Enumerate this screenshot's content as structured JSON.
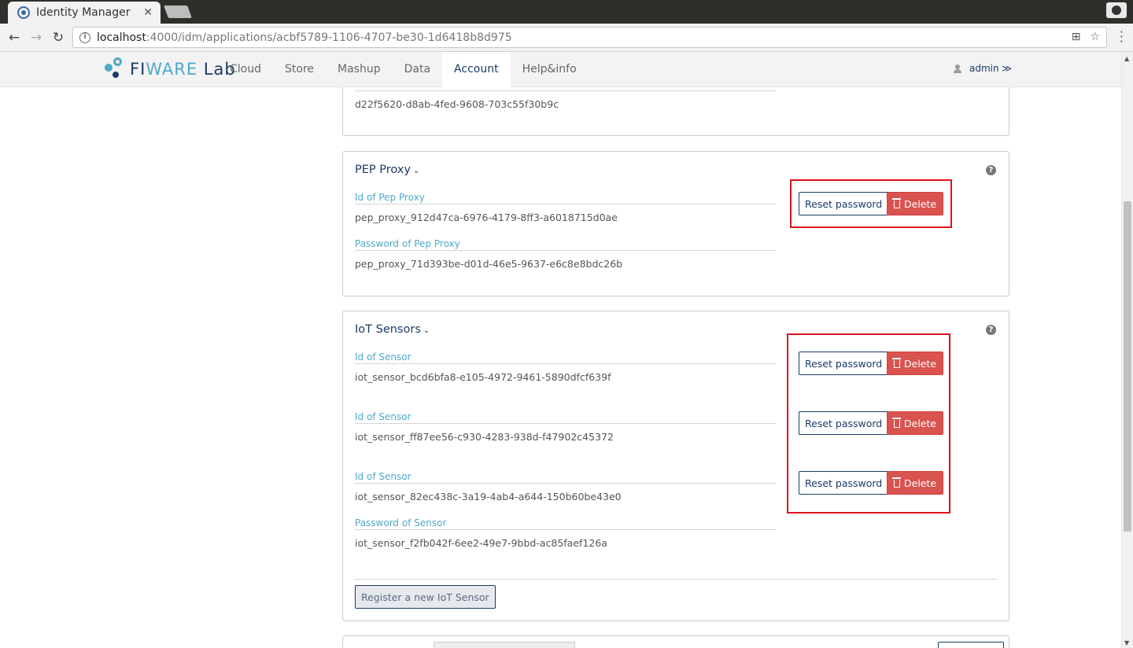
{
  "browser": {
    "tab_title": "Identity Manager",
    "tab_close": "✕",
    "url_host": "localhost",
    "url_rest": ":4000/idm/applications/acbf5789-1106-4707-be30-1d6418b8d975"
  },
  "header": {
    "brand_main": "FI",
    "brand_ware": "WARE",
    "brand_lab": " Lab",
    "nav": [
      {
        "label": "Cloud",
        "active": false
      },
      {
        "label": "Store",
        "active": false
      },
      {
        "label": "Mashup",
        "active": false
      },
      {
        "label": "Data",
        "active": false
      },
      {
        "label": "Account",
        "active": true
      },
      {
        "label": "Help&info",
        "active": false
      }
    ],
    "user": "admin ≫"
  },
  "top_panel": {
    "value": "d22f5620-d8ab-4fed-9608-703c55f30b9c"
  },
  "pep_proxy": {
    "title": "PEP Proxy",
    "id_label": "Id of Pep Proxy",
    "id_value": "pep_proxy_912d47ca-6976-4179-8ff3-a6018715d0ae",
    "password_label": "Password of Pep Proxy",
    "password_value": "pep_proxy_71d393be-d01d-46e5-9637-e6c8e8bdc26b",
    "reset_label": "Reset password",
    "delete_label": "Delete"
  },
  "iot": {
    "title": "IoT Sensors",
    "sensors": [
      {
        "label": "Id of Sensor",
        "value": "iot_sensor_bcd6bfa8-e105-4972-9461-5890dfcf639f"
      },
      {
        "label": "Id of Sensor",
        "value": "iot_sensor_ff87ee56-c930-4283-938d-f47902c45372"
      },
      {
        "label": "Id of Sensor",
        "value": "iot_sensor_82ec438c-3a19-4ab4-a644-150b60be43e0"
      }
    ],
    "password_label": "Password of Sensor",
    "password_value": "iot_sensor_f2fb042f-6ee2-49e7-9bbd-ac85faef126a",
    "reset_label": "Reset password",
    "delete_label": "Delete",
    "register_label": "Register a new IoT Sensor"
  }
}
